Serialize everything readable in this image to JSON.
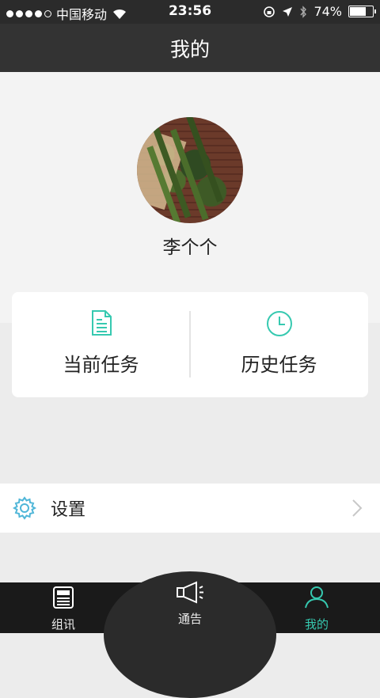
{
  "status_bar": {
    "carrier": "中国移动",
    "time": "23:56",
    "battery": "74%",
    "battery_level": 0.74
  },
  "navbar": {
    "title": "我的"
  },
  "profile": {
    "username": "李个个"
  },
  "tasks": {
    "current": {
      "label": "当前任务",
      "icon": "document-icon"
    },
    "history": {
      "label": "历史任务",
      "icon": "clock-icon"
    }
  },
  "settings": {
    "label": "设置",
    "icon": "gear-icon"
  },
  "tabbar": {
    "items": [
      {
        "label": "组讯",
        "icon": "newspaper-icon"
      },
      {
        "label": "通告",
        "icon": "megaphone-icon"
      },
      {
        "label": "我的",
        "icon": "person-icon",
        "active": true
      }
    ]
  },
  "colors": {
    "accent": "#36c9b0",
    "header": "#333333",
    "tabbar": "#1a1a1a"
  }
}
